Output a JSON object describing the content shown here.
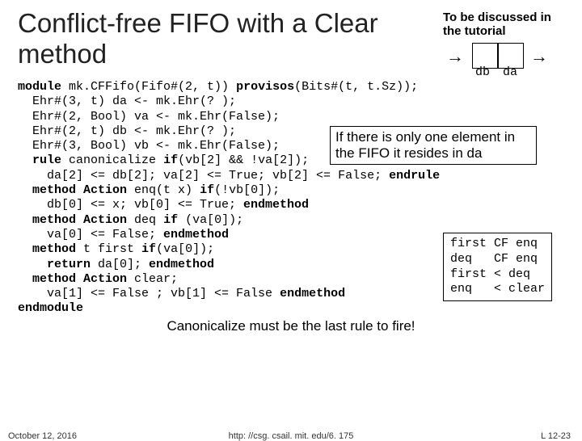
{
  "title": "Conflict-free FIFO with a Clear method",
  "discuss": "To be discussed in the tutorial",
  "diagram": {
    "left_label": "db",
    "right_label": "da"
  },
  "code": {
    "l1a": "module",
    "l1b": " mk.CFFifo(Fifo#(2, t)) ",
    "l1c": "provisos",
    "l1d": "(Bits#(t, t.Sz));",
    "l2": "  Ehr#(3, t) da <- mk.Ehr(? );",
    "l3": "  Ehr#(2, Bool) va <- mk.Ehr(False);",
    "l4": "  Ehr#(2, t) db <- mk.Ehr(? );",
    "l5": "  Ehr#(3, Bool) vb <- mk.Ehr(False);",
    "l6a": "  ",
    "l6b": "rule",
    "l6c": " canonicalize ",
    "l6d": "if",
    "l6e": "(vb[2] && !va[2]);",
    "l7a": "    da[2] <= db[2]; va[2] <= True; vb[2] <= False; ",
    "l7b": "endrule",
    "l8a": "  ",
    "l8b": "method Action",
    "l8c": " enq(t x) ",
    "l8d": "if",
    "l8e": "(!vb[0]);",
    "l9a": "    db[0] <= x; vb[0] <= True; ",
    "l9b": "endmethod",
    "l10a": "  ",
    "l10b": "method Action",
    "l10c": " deq ",
    "l10d": "if",
    "l10e": " (va[0]);",
    "l11a": "    va[0] <= False; ",
    "l11b": "endmethod",
    "l12a": "  ",
    "l12b": "method",
    "l12c": " t first ",
    "l12d": "if",
    "l12e": "(va[0]);",
    "l13a": "    ",
    "l13b": "return",
    "l13c": " da[0]; ",
    "l13d": "endmethod",
    "l14a": "  ",
    "l14b": "method Action",
    "l14c": " clear;",
    "l15a": "    va[1] <= False ; vb[1] <= False ",
    "l15b": "endmethod",
    "l16": "endmodule"
  },
  "callout1": "If there is only one element in the FIFO it resides in da",
  "callout2": "first CF enq\ndeq   CF enq\nfirst < deq\nenq   < clear",
  "canonical": "Canonicalize must be the last rule to fire!",
  "footer": {
    "date": "October 12, 2016",
    "url": "http: //csg. csail. mit. edu/6. 175",
    "page": "L 12-23"
  }
}
